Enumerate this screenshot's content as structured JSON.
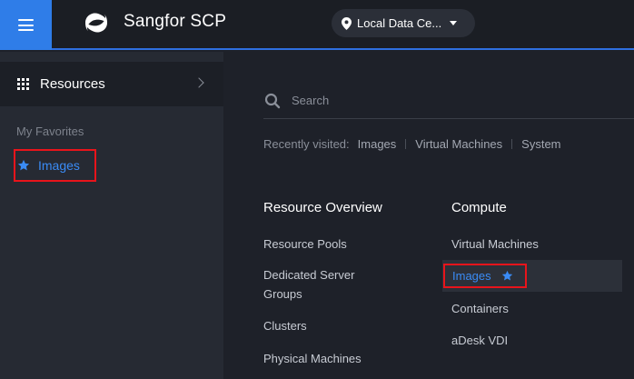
{
  "header": {
    "brand": "Sangfor SCP",
    "location": "Local Data Ce..."
  },
  "sidebar": {
    "resources_label": "Resources",
    "favorites_title": "My Favorites",
    "favorites": [
      {
        "label": "Images"
      }
    ]
  },
  "main": {
    "search_placeholder": "Search",
    "recent_label": "Recently visited:",
    "recent_items": [
      "Images",
      "Virtual Machines",
      "System"
    ],
    "columns": [
      {
        "title": "Resource Overview",
        "items": [
          "Resource Pools",
          "Dedicated Server Groups",
          "Clusters",
          "Physical Machines"
        ]
      },
      {
        "title": "Compute",
        "items": [
          "Virtual Machines",
          "Images",
          "Containers",
          "aDesk VDI"
        ]
      }
    ]
  },
  "colors": {
    "accent": "#2f7de8",
    "link_active": "#3a8bf5",
    "highlight_border": "#e8141b"
  },
  "icons": [
    "menu-icon",
    "sangfor-logo",
    "location-pin-icon",
    "chevron-down-icon",
    "grid-icon",
    "chevron-right-icon",
    "star-icon",
    "search-icon"
  ]
}
